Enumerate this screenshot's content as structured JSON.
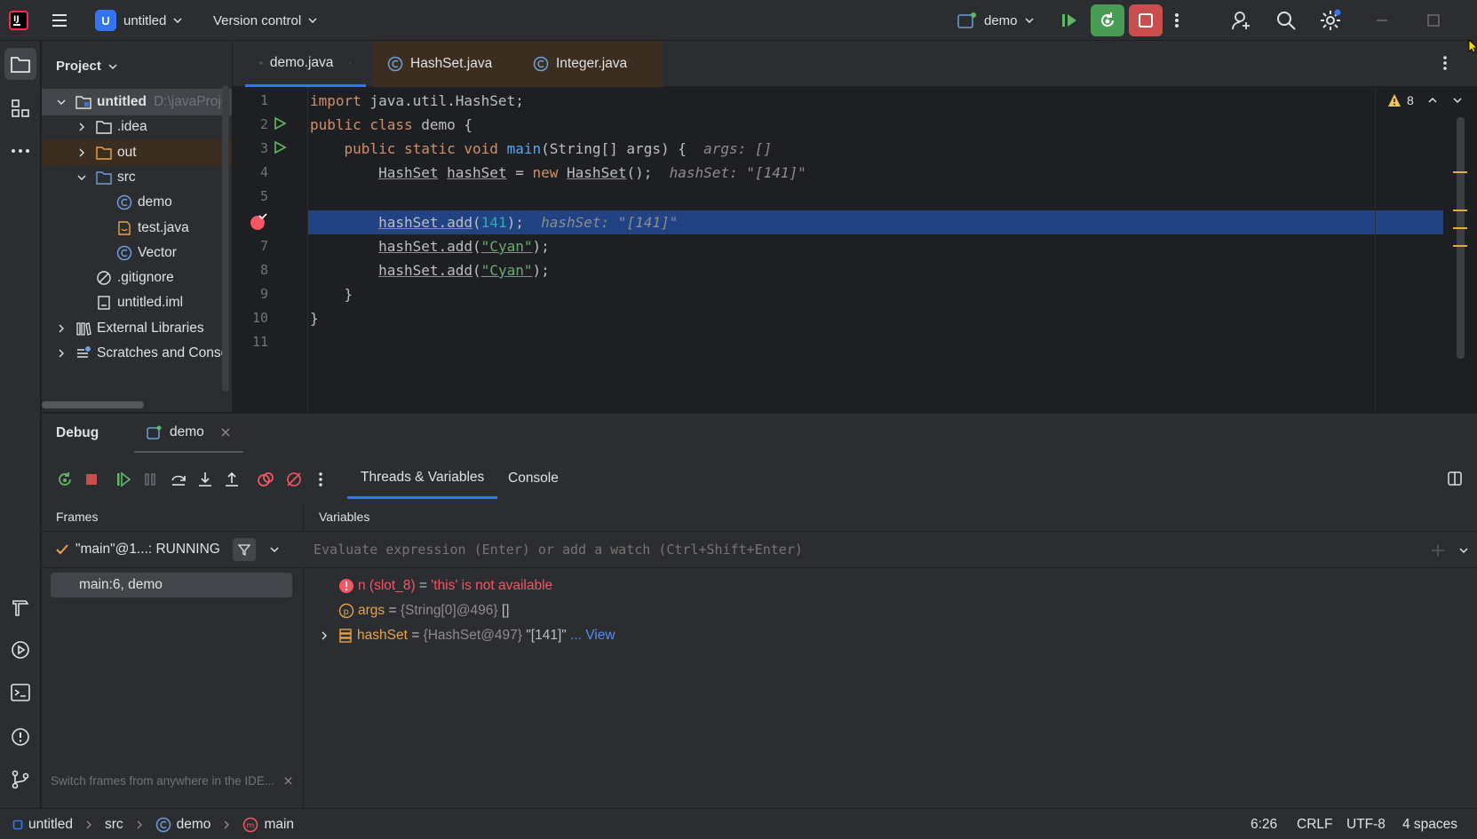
{
  "titlebar": {
    "project_initial": "U",
    "project_name": "untitled",
    "version_control": "Version control",
    "run_config": "demo"
  },
  "project_panel": {
    "title": "Project",
    "tree": [
      {
        "label": "untitled",
        "hint": "D:\\javaProje",
        "icon": "module-folder-icon",
        "depth": 0,
        "expanded": true
      },
      {
        "label": ".idea",
        "icon": "folder-icon",
        "depth": 1,
        "expanded": false
      },
      {
        "label": "out",
        "icon": "excluded-folder-icon",
        "depth": 1,
        "expanded": false
      },
      {
        "label": "src",
        "icon": "source-folder-icon",
        "depth": 1,
        "expanded": true
      },
      {
        "label": "demo",
        "icon": "java-class-icon",
        "depth": 2
      },
      {
        "label": "test.java",
        "icon": "java-file-icon",
        "depth": 2
      },
      {
        "label": "Vector",
        "icon": "java-class-icon",
        "depth": 2
      },
      {
        "label": ".gitignore",
        "icon": "ignore-file-icon",
        "depth": 1
      },
      {
        "label": "untitled.iml",
        "icon": "iml-file-icon",
        "depth": 1
      },
      {
        "label": "External Libraries",
        "icon": "library-icon",
        "depth": 0,
        "expanded": false
      },
      {
        "label": "Scratches and Conso",
        "icon": "scratches-icon",
        "depth": 0,
        "expanded": false
      }
    ]
  },
  "editor": {
    "tabs": [
      {
        "label": "demo.java",
        "active": true
      },
      {
        "label": "HashSet.java",
        "active": false
      },
      {
        "label": "Integer.java",
        "active": false
      }
    ],
    "warning_count": "8",
    "line_numbers": [
      "1",
      "2",
      "3",
      "4",
      "5",
      "6",
      "7",
      "8",
      "9",
      "10",
      "11"
    ],
    "current_line": 6
  },
  "debug": {
    "title": "Debug",
    "session_tab": "demo",
    "subtabs": [
      "Threads & Variables",
      "Console"
    ],
    "frames_header": "Frames",
    "variables_header": "Variables",
    "thread": "\"main\"@1...: RUNNING",
    "frame": "main:6, demo",
    "evaluate_placeholder": "Evaluate expression (Enter) or add a watch (Ctrl+Shift+Enter)",
    "variables": [
      {
        "name": "n (slot_8)",
        "eq": " = ",
        "value": "'this' is not available",
        "kind": "error"
      },
      {
        "name": "args",
        "eq": " = ",
        "type": "{String[0]@496}",
        "value": " []",
        "kind": "param"
      },
      {
        "name": "hashSet",
        "eq": " = ",
        "type": "{HashSet@497}",
        "value": " \"[141]\"",
        "link": " ... View",
        "kind": "local"
      }
    ],
    "frames_tip": "Switch frames from anywhere in the IDE..."
  },
  "statusbar": {
    "breadcrumbs": [
      "untitled",
      "src",
      "demo",
      "main"
    ],
    "position": "6:26",
    "line_sep": "CRLF",
    "encoding": "UTF-8",
    "indent": "4 spaces"
  },
  "colors": {
    "accent": "#3574f0",
    "debug_green": "#499c54",
    "stop_red": "#c94f4f",
    "breakpoint": "#f75464",
    "execution_line": "#214283"
  }
}
